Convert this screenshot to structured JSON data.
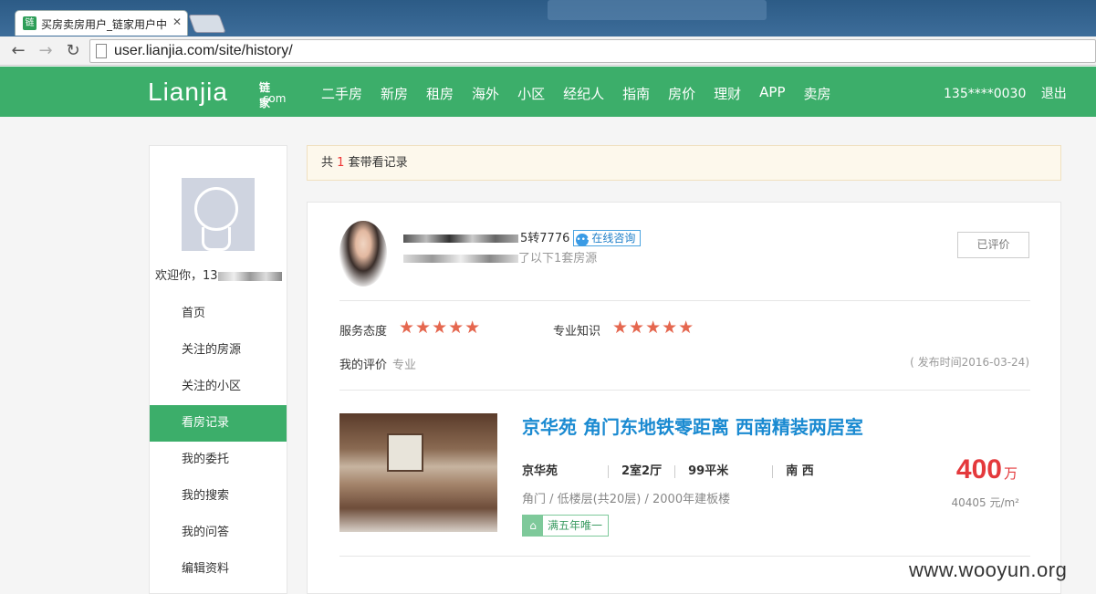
{
  "browser": {
    "tab_title": "买房卖房用户_链家用户中",
    "tab_favicon": "链",
    "url": "user.lianjia.com/site/history/"
  },
  "site": {
    "logo_text": "Lianjia",
    "logo_cn": "链家",
    "logo_com": ".com",
    "menu": [
      "二手房",
      "新房",
      "租房",
      "海外",
      "小区",
      "经纪人",
      "指南",
      "房价",
      "理财",
      "APP",
      "卖房"
    ],
    "user_phone": "135****0030",
    "logout": "退出",
    "brand_color": "#3cae6a"
  },
  "sidebar": {
    "welcome": "欢迎你，13",
    "items": [
      {
        "label": "首页"
      },
      {
        "label": "关注的房源"
      },
      {
        "label": "关注的小区"
      },
      {
        "label": "看房记录"
      },
      {
        "label": "我的委托"
      },
      {
        "label": "我的搜索"
      },
      {
        "label": "我的问答"
      },
      {
        "label": "编辑资料"
      }
    ],
    "active_index": 3
  },
  "notice": {
    "prefix": "共",
    "count": "1",
    "suffix": "套带看记录"
  },
  "record": {
    "agent_phone_tail": "5转7776",
    "consult_label": "在线咨询",
    "visit_text": "了以下1套房源",
    "rated_label": "已评价",
    "service_label": "服务态度",
    "service_stars": 5,
    "knowledge_label": "专业知识",
    "knowledge_stars": 5,
    "comment_label": "我的评价",
    "comment_text": "专业",
    "publish_date": "( 发布时间2016-03-24)",
    "house": {
      "title": "京华苑 角门东地铁零距离 西南精装两居室",
      "community": "京华苑",
      "layout": "2室2厅",
      "area": "99平米",
      "orientation": "南 西",
      "district": "角门",
      "floor": "低楼层(共20层)",
      "built": "2000年建板楼",
      "tag": "满五年唯一",
      "price": "400",
      "price_unit": "万",
      "unit_price": "40405 元/m²"
    }
  },
  "watermark": "www.wooyun.org"
}
